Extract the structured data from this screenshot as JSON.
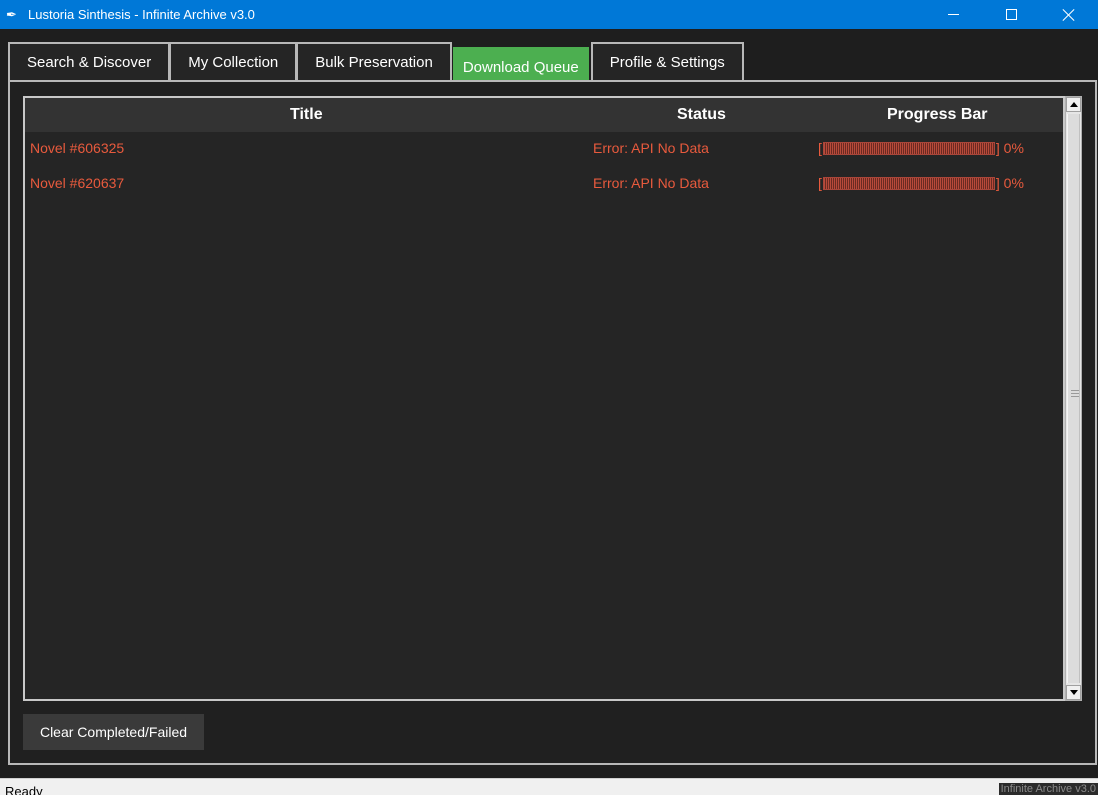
{
  "window": {
    "title": "Lustoria Sinthesis - Infinite Archive v3.0",
    "app_icon": "quill-icon",
    "accent": "#0078d7"
  },
  "tabs": [
    {
      "label": "Search & Discover",
      "active": false
    },
    {
      "label": "My Collection",
      "active": false
    },
    {
      "label": "Bulk Preservation",
      "active": false
    },
    {
      "label": "Download Queue",
      "active": true
    },
    {
      "label": "Profile & Settings",
      "active": false
    }
  ],
  "active_tab_color": "#4caf50",
  "queue": {
    "columns": [
      "Title",
      "Status",
      "Progress Bar"
    ],
    "rows": [
      {
        "title": "Novel #606325",
        "status": "Error: API No Data",
        "bar_left": "[",
        "bar_right": "] 0%",
        "progress": 0
      },
      {
        "title": "Novel #620637",
        "status": "Error: API No Data",
        "bar_left": "[",
        "bar_right": "] 0%",
        "progress": 0
      }
    ],
    "error_color": "#e85a3d"
  },
  "actions": {
    "clear_label": "Clear Completed/Failed"
  },
  "status": {
    "text": "Ready",
    "version": "Infinite Archive v3.0"
  }
}
